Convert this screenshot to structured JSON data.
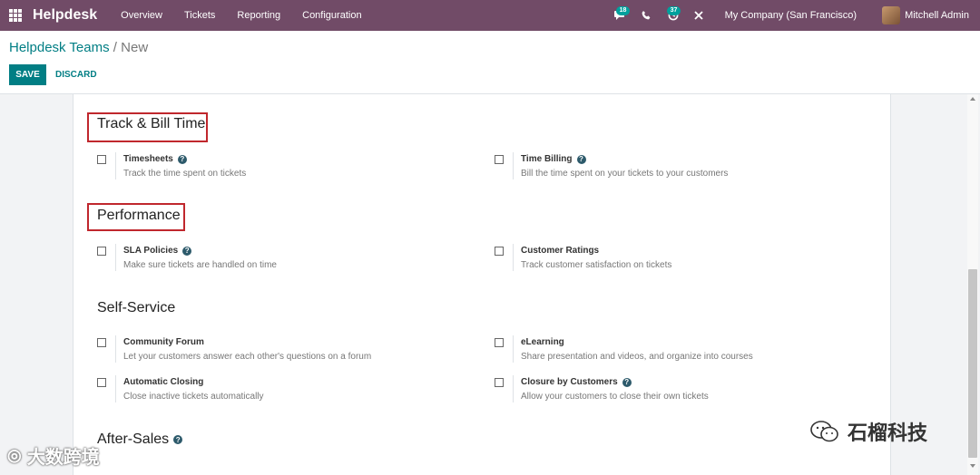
{
  "navbar": {
    "brand": "Helpdesk",
    "menu": [
      "Overview",
      "Tickets",
      "Reporting",
      "Configuration"
    ],
    "chat_badge": "18",
    "activity_badge": "37",
    "company": "My Company (San Francisco)",
    "user": "Mitchell Admin",
    "icons": [
      "apps-grid-icon",
      "chat-icon",
      "phone-icon",
      "activity-clock-icon",
      "close-icon"
    ]
  },
  "breadcrumb": {
    "parent": "Helpdesk Teams",
    "separator": " / ",
    "current": "New"
  },
  "buttons": {
    "save": "SAVE",
    "discard": "DISCARD"
  },
  "sections": {
    "track_bill": {
      "title": "Track & Bill Time",
      "left": {
        "label": "Timesheets",
        "desc": "Track the time spent on tickets",
        "help": true
      },
      "right": {
        "label": "Time Billing",
        "desc": "Bill the time spent on your tickets to your customers",
        "help": true
      }
    },
    "performance": {
      "title": "Performance",
      "left": {
        "label": "SLA Policies",
        "desc": "Make sure tickets are handled on time",
        "help": true
      },
      "right": {
        "label": "Customer Ratings",
        "desc": "Track customer satisfaction on tickets",
        "help": false
      }
    },
    "self_service": {
      "title": "Self-Service",
      "row1_left": {
        "label": "Community Forum",
        "desc": "Let your customers answer each other's questions on a forum",
        "help": false
      },
      "row1_right": {
        "label": "eLearning",
        "desc": "Share presentation and videos, and organize into courses",
        "help": false
      },
      "row2_left": {
        "label": "Automatic Closing",
        "desc": "Close inactive tickets automatically",
        "help": false
      },
      "row2_right": {
        "label": "Closure by Customers",
        "desc": "Allow your customers to close their own tickets",
        "help": true
      }
    },
    "after_sales": {
      "title": "After-Sales"
    }
  },
  "help_glyph": "?",
  "watermarks": {
    "left": "大数跨境",
    "right": "石榴科技"
  },
  "colors": {
    "navbar": "#714b67",
    "primary": "#017e84",
    "highlight_box": "#c0272d",
    "badge": "#00a09d"
  }
}
